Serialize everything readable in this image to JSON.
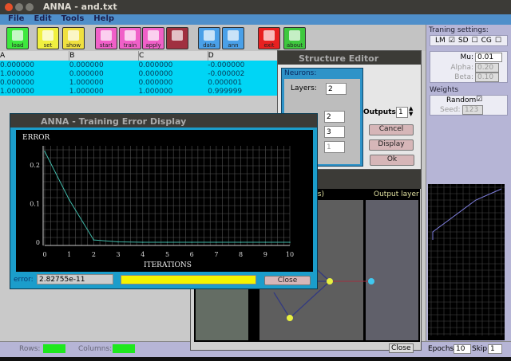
{
  "window": {
    "title": "ANNA - and.txt"
  },
  "menu": [
    "File",
    "Edit",
    "Tools",
    "Help"
  ],
  "toolbar": [
    {
      "label": "load",
      "color": "#3ee83e",
      "icon": "document-icon"
    },
    {
      "label": "set",
      "color": "#f0f040",
      "icon": "sliders-icon"
    },
    {
      "label": "show",
      "color": "#f0e040",
      "icon": "network-icon"
    },
    {
      "label": "start",
      "color": "#f060c8",
      "icon": "check-icon"
    },
    {
      "label": "train",
      "color": "#f060c8",
      "icon": "brain-icon"
    },
    {
      "label": "apply",
      "color": "#f060c8",
      "icon": "wand-icon"
    },
    {
      "label": "",
      "color": "#a03040",
      "icon": "stop-icon"
    },
    {
      "label": "data",
      "color": "#4aa0e8",
      "icon": "floppy-icon"
    },
    {
      "label": "ann",
      "color": "#4aa0e8",
      "icon": "floppy-icon"
    },
    {
      "label": "exit",
      "color": "#e82020",
      "icon": "close-icon"
    },
    {
      "label": "about",
      "color": "#3ec83e",
      "icon": "info-icon"
    }
  ],
  "table": {
    "columns": [
      "A",
      "B",
      "C",
      "D"
    ],
    "rows": [
      [
        "0.000000",
        "0.000000",
        "0.000000",
        "-0.000000"
      ],
      [
        "1.000000",
        "0.000000",
        "0.000000",
        "-0.000002"
      ],
      [
        "0.000000",
        "1.000000",
        "0.000000",
        "0.000001"
      ],
      [
        "1.000000",
        "1.000000",
        "1.000000",
        "0.999999"
      ]
    ]
  },
  "structure_editor": {
    "title": "Structure Editor",
    "neurons_label": "Neurons:",
    "layers_label": "Layers:",
    "layers": "2",
    "layer1": "2",
    "layer2": "3",
    "layer3": "1",
    "outputs_label": "Outputs:",
    "outputs": "1",
    "cancel": "Cancel",
    "display": "Display",
    "ok": "Ok"
  },
  "network_view": {
    "hidden_label": "er(s)",
    "output_label": "Output layer",
    "close": "Close"
  },
  "error_window": {
    "title": "ANNA - Training Error Display",
    "error_label": "error:",
    "error_value": "2.82755e-11",
    "close": "Close",
    "progress": 1.0
  },
  "chart_data": {
    "type": "line",
    "title": "",
    "ylabel": "ERROR",
    "xlabel": "ITERATIONS",
    "x": [
      0,
      1,
      2,
      3,
      4,
      5,
      6,
      7,
      8,
      9,
      10
    ],
    "values": [
      0.235,
      0.11,
      0.006,
      0.001,
      0,
      0,
      0,
      0,
      0,
      0,
      0
    ],
    "xlim": [
      0,
      10
    ],
    "ylim": [
      0,
      0.2
    ],
    "xticks": [
      "0",
      "1",
      "2",
      "3",
      "4",
      "5",
      "6",
      "7",
      "8",
      "9",
      "10"
    ],
    "yticks": [
      "0",
      "0.1",
      "0.2"
    ],
    "grid": true
  },
  "settings": {
    "title": "Traning settings:",
    "lm": "LM",
    "sd": "SD",
    "cg": "CG",
    "mu_label": "Mu:",
    "mu": "0.01",
    "alpha_label": "Alpha:",
    "alpha": "0.20",
    "beta_label": "Beta:",
    "beta": "0.10",
    "weights_title": "Weights",
    "random_label": "Random",
    "seed_label": "Seed:",
    "seed": "123",
    "epochs_label": "Epochs:",
    "epochs": "10",
    "skip_label": "Skip:",
    "skip": "1"
  },
  "status": {
    "rows_label": "Rows:",
    "columns_label": "Columns:"
  }
}
